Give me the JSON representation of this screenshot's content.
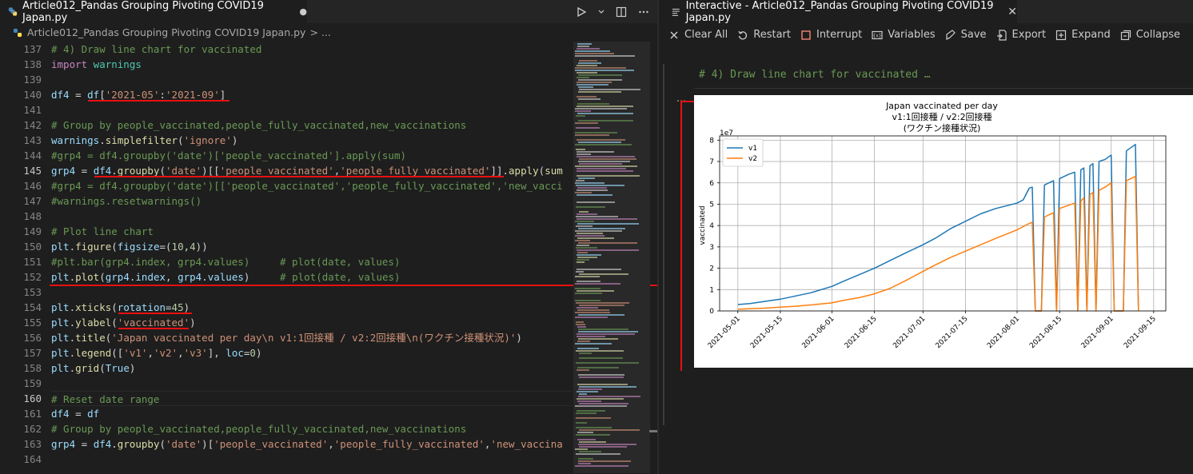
{
  "editor": {
    "tab_label": "Article012_Pandas Grouping Pivoting COVID19 Japan.py",
    "dirty_indicator": "●",
    "breadcrumb": "Article012_Pandas Grouping Pivoting COVID19 Japan.py",
    "breadcrumb_suffix": "> ...",
    "line_numbers": [
      "137",
      "138",
      "139",
      "140",
      "141",
      "142",
      "143",
      "144",
      "145",
      "146",
      "147",
      "148",
      "149",
      "150",
      "151",
      "152",
      "153",
      "154",
      "155",
      "156",
      "157",
      "158",
      "159",
      "160",
      "161",
      "162",
      "163",
      "164"
    ],
    "code": {
      "l137": "# 4) Draw line chart for vaccinated",
      "l138_kw": "import",
      "l138_mod": " warnings",
      "l140_a": "df4",
      "l140_b": " = ",
      "l140_c": "df",
      "l140_d": "[",
      "l140_e": "'2021-05'",
      "l140_f": ":",
      "l140_g": "'2021-09'",
      "l140_h": "]",
      "l142": "# Group by people_vaccinated,people_fully_vaccinated,new_vaccinations",
      "l143_a": "warnings",
      "l143_b": ".",
      "l143_c": "simplefilter",
      "l143_d": "(",
      "l143_e": "'ignore'",
      "l143_f": ")",
      "l144": "#grp4 = df4.groupby('date')['people_vaccinated'].apply(sum)",
      "l145_a": "grp4",
      "l145_b": " = ",
      "l145_c": "df4",
      "l145_d": ".",
      "l145_e": "groupby",
      "l145_f": "(",
      "l145_g": "'date'",
      "l145_h": ")[[",
      "l145_i": "'people_vaccinated'",
      "l145_j": ",",
      "l145_k": "'people_fully_vaccinated'",
      "l145_l": "]].",
      "l145_m": "apply",
      "l145_n": "(",
      "l145_o": "sum",
      "l146": "#grp4 = df4.groupby('date')[['people_vaccinated','people_fully_vaccinated','new_vacci",
      "l147": "#warnings.resetwarnings()",
      "l149": "# Plot line chart",
      "l150_a": "plt",
      "l150_b": ".",
      "l150_c": "figure",
      "l150_d": "(",
      "l150_e": "figsize",
      "l150_f": "=(",
      "l150_g": "10",
      "l150_h": ",",
      "l150_i": "4",
      "l150_j": "))",
      "l151": "#plt.bar(grp4.index, grp4.values)     # plot(date, values)",
      "l152_a": "plt",
      "l152_b": ".",
      "l152_c": "plot",
      "l152_d": "(",
      "l152_e": "grp4",
      "l152_f": ".",
      "l152_g": "index",
      "l152_h": ", ",
      "l152_i": "grp4",
      "l152_j": ".",
      "l152_k": "values",
      "l152_l": ")     ",
      "l152_m": "# plot(date, values)",
      "l154_a": "plt",
      "l154_b": ".",
      "l154_c": "xticks",
      "l154_d": "(",
      "l154_e": "rotation",
      "l154_f": "=",
      "l154_g": "45",
      "l154_h": ")",
      "l155_a": "plt",
      "l155_b": ".",
      "l155_c": "ylabel",
      "l155_d": "(",
      "l155_e": "'vaccinated'",
      "l155_f": ")",
      "l156_a": "plt",
      "l156_b": ".",
      "l156_c": "title",
      "l156_d": "(",
      "l156_e": "'Japan vaccinated per day\\n v1:1回接種 / v2:2回接種\\n(ワクチン接種状況)'",
      "l156_f": ")",
      "l157_a": "plt",
      "l157_b": ".",
      "l157_c": "legend",
      "l157_d": "([",
      "l157_e": "'v1'",
      "l157_f": ",",
      "l157_g": "'v2'",
      "l157_h": ",",
      "l157_i": "'v3'",
      "l157_j": "], ",
      "l157_k": "loc",
      "l157_l": "=",
      "l157_m": "0",
      "l157_n": ")",
      "l158_a": "plt",
      "l158_b": ".",
      "l158_c": "grid",
      "l158_d": "(",
      "l158_e": "True",
      "l158_f": ")",
      "l160": "# Reset date range",
      "l161_a": "df4",
      "l161_b": " = ",
      "l161_c": "df",
      "l162": "# Group by people_vaccinated,people_fully_vaccinated,new_vaccinations",
      "l163_a": "grp4",
      "l163_b": " = ",
      "l163_c": "df4",
      "l163_d": ".",
      "l163_e": "groupby",
      "l163_f": "(",
      "l163_g": "'date'",
      "l163_h": ")[",
      "l163_i": "'people_vaccinated'",
      "l163_j": ",",
      "l163_k": "'people_fully_vaccinated'",
      "l163_l": ",",
      "l163_m": "'new_vaccina"
    }
  },
  "interactive": {
    "tab_label": "Interactive - Article012_Pandas Grouping Pivoting COVID19 Japan.py",
    "close_glyph": "✕",
    "toolbar": {
      "clear_all": "Clear All",
      "restart": "Restart",
      "interrupt": "Interrupt",
      "variables": "Variables",
      "save": "Save",
      "export": "Export",
      "expand": "Expand",
      "collapse": "Collapse"
    },
    "cell_header": "# 4) Draw line chart for vaccinated …",
    "cell_dots": "…"
  },
  "colors": {
    "v1": "#1f77b4",
    "v2": "#ff7f0e",
    "annotation": "#e81010"
  },
  "chart_data": {
    "type": "line",
    "title": "Japan vaccinated per day",
    "subtitle_1": "v1:1回接種 / v2:2回接種",
    "subtitle_2": "(ワクチン接種状況)",
    "ylabel": "vaccinated",
    "xlabel": "",
    "y_scale_label": "1e7",
    "yticks": [
      "0",
      "1",
      "2",
      "3",
      "4",
      "5",
      "6",
      "7",
      "8"
    ],
    "xticks": [
      "2021-05-01",
      "2021-05-15",
      "2021-06-01",
      "2021-06-15",
      "2021-07-01",
      "2021-07-15",
      "2021-08-01",
      "2021-08-15",
      "2021-09-01",
      "2021-09-15"
    ],
    "grid": true,
    "legend_position": "top-left",
    "ylim": [
      0,
      8.2
    ],
    "series": [
      {
        "name": "v1",
        "values": [
          [
            "2021-05-01",
            0.3
          ],
          [
            "2021-05-05",
            0.35
          ],
          [
            "2021-05-10",
            0.45
          ],
          [
            "2021-05-15",
            0.55
          ],
          [
            "2021-05-20",
            0.7
          ],
          [
            "2021-05-25",
            0.85
          ],
          [
            "2021-06-01",
            1.15
          ],
          [
            "2021-06-05",
            1.4
          ],
          [
            "2021-06-10",
            1.7
          ],
          [
            "2021-06-15",
            2.0
          ],
          [
            "2021-06-20",
            2.35
          ],
          [
            "2021-06-25",
            2.7
          ],
          [
            "2021-07-01",
            3.1
          ],
          [
            "2021-07-05",
            3.4
          ],
          [
            "2021-07-10",
            3.85
          ],
          [
            "2021-07-15",
            4.2
          ],
          [
            "2021-07-20",
            4.55
          ],
          [
            "2021-07-25",
            4.8
          ],
          [
            "2021-08-01",
            5.05
          ],
          [
            "2021-08-03",
            5.2
          ],
          [
            "2021-08-05",
            5.75
          ],
          [
            "2021-08-06",
            5.8
          ],
          [
            "2021-08-07",
            0.0
          ],
          [
            "2021-08-09",
            0.0
          ],
          [
            "2021-08-10",
            5.9
          ],
          [
            "2021-08-13",
            6.1
          ],
          [
            "2021-08-14",
            0.0
          ],
          [
            "2021-08-15",
            6.2
          ],
          [
            "2021-08-18",
            6.4
          ],
          [
            "2021-08-20",
            6.5
          ],
          [
            "2021-08-21",
            0.0
          ],
          [
            "2021-08-22",
            6.6
          ],
          [
            "2021-08-23",
            6.7
          ],
          [
            "2021-08-24",
            0.0
          ],
          [
            "2021-08-25",
            6.8
          ],
          [
            "2021-08-26",
            6.9
          ],
          [
            "2021-08-27",
            0.0
          ],
          [
            "2021-08-28",
            7.0
          ],
          [
            "2021-08-30",
            7.1
          ],
          [
            "2021-08-31",
            7.2
          ],
          [
            "2021-09-01",
            7.3
          ],
          [
            "2021-09-02",
            0.0
          ],
          [
            "2021-09-05",
            0.0
          ],
          [
            "2021-09-06",
            7.5
          ],
          [
            "2021-09-09",
            7.8
          ],
          [
            "2021-09-10",
            0.0
          ]
        ]
      },
      {
        "name": "v2",
        "values": [
          [
            "2021-05-01",
            0.08
          ],
          [
            "2021-05-05",
            0.1
          ],
          [
            "2021-05-10",
            0.13
          ],
          [
            "2021-05-15",
            0.18
          ],
          [
            "2021-05-20",
            0.22
          ],
          [
            "2021-05-25",
            0.28
          ],
          [
            "2021-06-01",
            0.38
          ],
          [
            "2021-06-05",
            0.5
          ],
          [
            "2021-06-10",
            0.62
          ],
          [
            "2021-06-15",
            0.8
          ],
          [
            "2021-06-20",
            1.05
          ],
          [
            "2021-06-25",
            1.4
          ],
          [
            "2021-07-01",
            1.85
          ],
          [
            "2021-07-05",
            2.15
          ],
          [
            "2021-07-10",
            2.5
          ],
          [
            "2021-07-15",
            2.8
          ],
          [
            "2021-07-20",
            3.1
          ],
          [
            "2021-07-25",
            3.4
          ],
          [
            "2021-08-01",
            3.8
          ],
          [
            "2021-08-03",
            3.95
          ],
          [
            "2021-08-05",
            4.1
          ],
          [
            "2021-08-06",
            4.15
          ],
          [
            "2021-08-07",
            0.0
          ],
          [
            "2021-08-09",
            0.0
          ],
          [
            "2021-08-10",
            4.4
          ],
          [
            "2021-08-13",
            4.6
          ],
          [
            "2021-08-14",
            0.0
          ],
          [
            "2021-08-15",
            4.8
          ],
          [
            "2021-08-18",
            4.95
          ],
          [
            "2021-08-20",
            5.05
          ],
          [
            "2021-08-21",
            0.0
          ],
          [
            "2021-08-22",
            5.15
          ],
          [
            "2021-08-23",
            5.3
          ],
          [
            "2021-08-24",
            0.0
          ],
          [
            "2021-08-25",
            5.45
          ],
          [
            "2021-08-26",
            5.55
          ],
          [
            "2021-08-27",
            0.0
          ],
          [
            "2021-08-28",
            5.65
          ],
          [
            "2021-08-30",
            5.8
          ],
          [
            "2021-08-31",
            5.9
          ],
          [
            "2021-09-01",
            6.0
          ],
          [
            "2021-09-02",
            0.0
          ],
          [
            "2021-09-05",
            0.0
          ],
          [
            "2021-09-06",
            6.1
          ],
          [
            "2021-09-09",
            6.3
          ],
          [
            "2021-09-10",
            0.0
          ]
        ]
      }
    ]
  }
}
